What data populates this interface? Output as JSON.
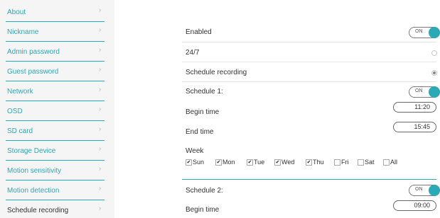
{
  "sidebar": {
    "items": [
      {
        "label": "About"
      },
      {
        "label": "Nickname"
      },
      {
        "label": "Admin password"
      },
      {
        "label": "Guest password"
      },
      {
        "label": "Network"
      },
      {
        "label": "OSD"
      },
      {
        "label": "SD card"
      },
      {
        "label": "Storage Device"
      },
      {
        "label": "Motion sensitivity"
      },
      {
        "label": "Motion detection"
      },
      {
        "label": "Schedule recording",
        "active": true
      }
    ],
    "chevron": "›"
  },
  "main": {
    "enabled_label": "Enabled",
    "enabled_toggle": "ON",
    "always_label": "24/7",
    "always_selected": false,
    "schedule_mode_label": "Schedule recording",
    "schedule_mode_selected": true,
    "schedule1": {
      "label": "Schedule 1:",
      "toggle": "ON",
      "begin_label": "Begin time",
      "begin_value": "11:20",
      "end_label": "End time",
      "end_value": "15:45",
      "week_label": "Week",
      "days": [
        {
          "label": "Sun",
          "checked": true
        },
        {
          "label": "Mon",
          "checked": true
        },
        {
          "label": "Tue",
          "checked": true
        },
        {
          "label": "Wed",
          "checked": true
        },
        {
          "label": "Thu",
          "checked": true
        },
        {
          "label": "Fri",
          "checked": false
        },
        {
          "label": "Sat",
          "checked": false
        },
        {
          "label": "All",
          "checked": false
        }
      ]
    },
    "schedule2": {
      "label": "Schedule 2:",
      "toggle": "ON",
      "begin_label": "Begin time",
      "begin_value": "09:00"
    }
  },
  "colors": {
    "accent": "#2aa9b6",
    "sidebar_bg": "#f5f5f5",
    "text": "#333333"
  },
  "icons": {
    "chevron": "chevron-right-icon",
    "check": "checkmark-icon"
  }
}
